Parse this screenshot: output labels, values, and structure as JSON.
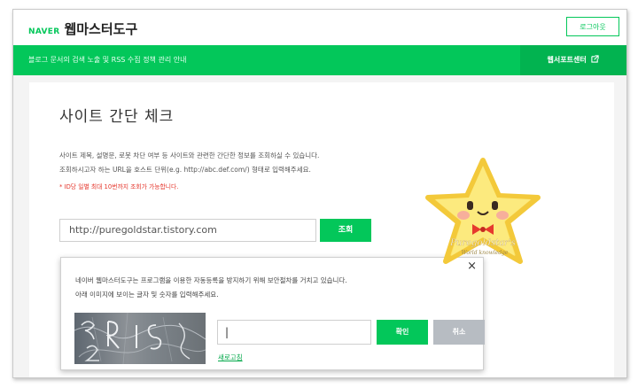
{
  "header": {
    "brand_naver": "NAVER",
    "brand_title": "웹마스터도구",
    "logout_label": "로그아웃"
  },
  "banner": {
    "notice": "블로그 문서의 검색 노출 및 RSS 수집 정책 관리 안내",
    "support_label": "웹서포트센터"
  },
  "main": {
    "title": "사이트 간단 체크",
    "desc_line1": "사이트 제목, 설명문, 로봇 차단 여부 등 사이트와 관련한 간단한 정보를 조회하실 수 있습니다.",
    "desc_line2": "조회하시고자 하는 URL을 호스트 단위(e.g. http://abc.def.com/) 형태로 입력해주세요.",
    "warning": "* ID당 일별 최대 10번까지 조회가 가능합니다.",
    "url_value": "http://puregoldstar.tistory.com",
    "query_label": "조회"
  },
  "captcha_popup": {
    "close_glyph": "×",
    "message_line1": "네이버 웹마스터도구는 프로그램을 이용한 자동등록을 방지하기 위해 보안절차를 거치고 있습니다.",
    "message_line2": "아래 이미지에 보이는 글자 및 숫자를 입력해주세요.",
    "input_value": "|",
    "confirm_label": "확인",
    "cancel_label": "취소",
    "refresh_label": "새로고침"
  },
  "sticker": {
    "text_line1": "Puregoldstar's",
    "text_line2": "World knowledge"
  },
  "colors": {
    "brand_green": "#03c75a",
    "warning_red": "#e5352b",
    "cancel_gray": "#b7bcc2"
  },
  "icons": {
    "external_link": "external-link-icon",
    "close": "close-icon"
  }
}
